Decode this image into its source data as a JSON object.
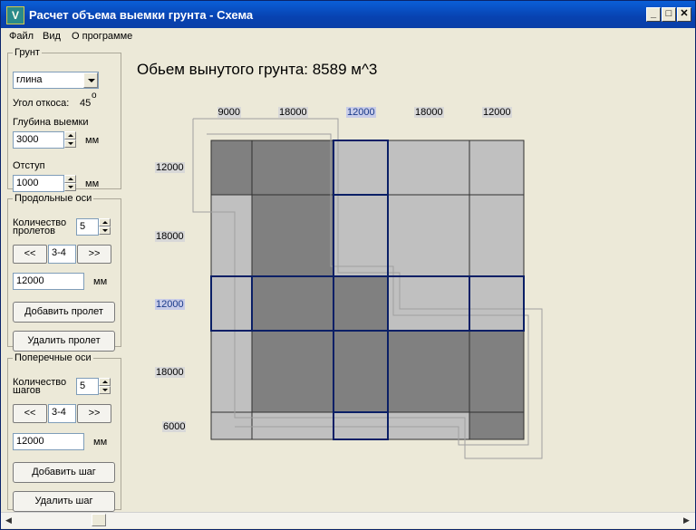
{
  "window": {
    "title": "Расчет объема выемки грунта - Схема",
    "min_glyph": "_",
    "max_glyph": "□",
    "close_glyph": "✕"
  },
  "menu": {
    "file": "Файл",
    "view": "Вид",
    "about": "О программе"
  },
  "ground": {
    "legend": "Грунт",
    "type_value": "глина",
    "slope_label": "Угол откоса:",
    "slope_value": "45",
    "slope_unit": "o",
    "depth_label": "Глубина выемки",
    "depth_value": "3000",
    "depth_unit": "мм",
    "offset_label": "Отступ",
    "offset_value": "1000",
    "offset_unit": "мм"
  },
  "long_axes": {
    "legend": "Продольные оси",
    "count_label_1": "Количество",
    "count_label_2": "пролетов",
    "count_value": "5",
    "prev": "<<",
    "current": "3-4",
    "next": ">>",
    "size_value": "12000",
    "size_unit": "мм",
    "add": "Добавить пролет",
    "remove": "Удалить пролет"
  },
  "cross_axes": {
    "legend": "Поперечные оси",
    "count_label_1": "Количество",
    "count_label_2": "шагов",
    "count_value": "5",
    "prev": "<<",
    "current": "3-4",
    "next": ">>",
    "size_value": "12000",
    "size_unit": "мм",
    "add": "Добавить шаг",
    "remove": "Удалить шаг"
  },
  "scheme": {
    "volume_text": "Обьем вынутого грунта: 8589 м^3",
    "columns": [
      9000,
      18000,
      12000,
      18000,
      12000
    ],
    "rows": [
      12000,
      18000,
      12000,
      18000,
      6000
    ],
    "selected_column": 2,
    "selected_row": 2,
    "cells": [
      [
        "dark",
        "dark",
        "light",
        "light",
        "light"
      ],
      [
        "light",
        "dark",
        "light",
        "light",
        "light"
      ],
      [
        "light",
        "dark",
        "dark",
        "light",
        "light"
      ],
      [
        "light",
        "dark",
        "dark",
        "dark",
        "dark"
      ],
      [
        "light",
        "light",
        "light",
        "light",
        "dark"
      ]
    ],
    "colors": {
      "dark": "#808080",
      "light": "#c0c0c0",
      "select": "#0a1f66",
      "outline": "#a0a0a0"
    }
  }
}
